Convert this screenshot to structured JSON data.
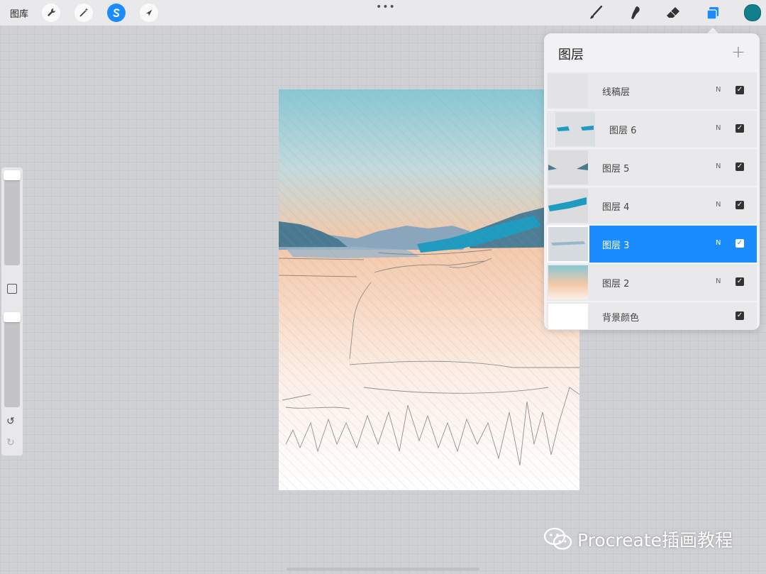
{
  "topbar": {
    "gallery_label": "图库",
    "more_dots": "•••",
    "current_color": "#117f8c",
    "accent": "#1a8cff"
  },
  "icons": {
    "actions": "wrench-icon",
    "adjustments": "magic-wand-icon",
    "selection": "selection-s-icon",
    "transform": "arrow-cursor-icon",
    "brush": "brush-icon",
    "smudge": "smudge-icon",
    "eraser": "eraser-icon",
    "layers": "layers-icon"
  },
  "sidebar": {
    "undo": "↺",
    "redo": "↻"
  },
  "layers_panel": {
    "title": "图层",
    "add": "+",
    "layers": [
      {
        "name": "线稿层",
        "blend": "N",
        "visible": true,
        "selected": false
      },
      {
        "name": "图层 6",
        "blend": "N",
        "visible": true,
        "selected": false
      },
      {
        "name": "图层 5",
        "blend": "N",
        "visible": true,
        "selected": false
      },
      {
        "name": "图层 4",
        "blend": "N",
        "visible": true,
        "selected": false
      },
      {
        "name": "图层 3",
        "blend": "N",
        "visible": true,
        "selected": true
      },
      {
        "name": "图层 2",
        "blend": "N",
        "visible": true,
        "selected": false
      },
      {
        "name": "背景颜色",
        "blend": "",
        "visible": true,
        "selected": false
      }
    ],
    "check": "✓"
  },
  "watermark": {
    "text": "Procreate插画教程"
  }
}
